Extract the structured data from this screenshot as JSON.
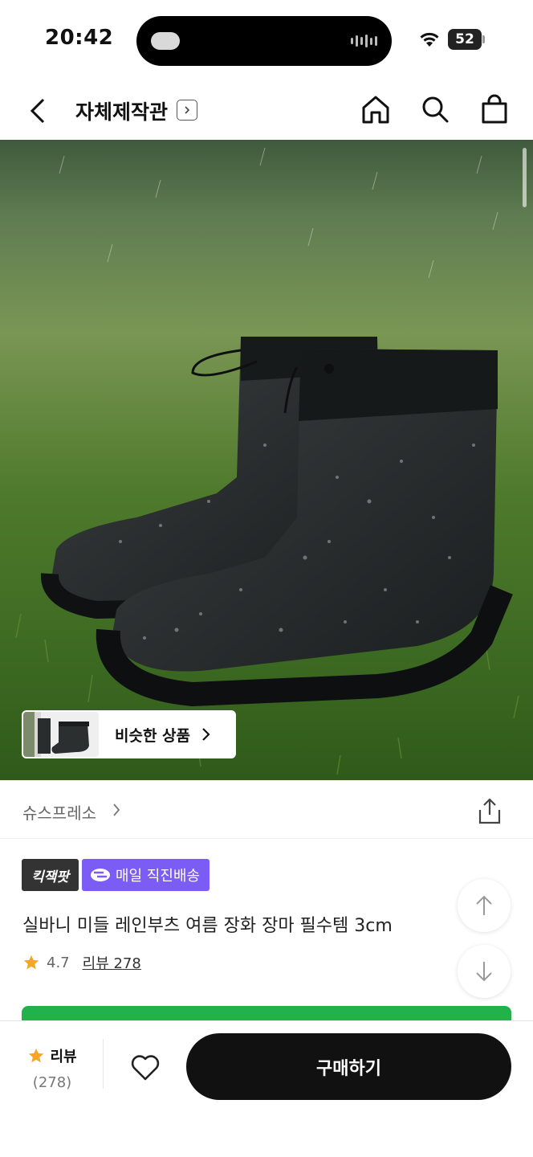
{
  "status_bar": {
    "time": "20:42",
    "battery": "52"
  },
  "nav": {
    "title": "자체제작관"
  },
  "similar": {
    "label": "비슷한 상품"
  },
  "brand": {
    "name": "슈스프레소"
  },
  "badges": {
    "quick": "킥잭팟",
    "delivery": "매일 직진배송"
  },
  "product": {
    "title": "실바니 미들 레인부츠 여름 장화 장마 필수템 3cm",
    "rating": "4.7",
    "review_text": "리뷰 278"
  },
  "bottom_bar": {
    "review_label": "리뷰",
    "review_count": "(278)",
    "buy_label": "구매하기"
  },
  "colors": {
    "accent_purple": "#7b5cf5",
    "star": "#f5a623",
    "green": "#22b24c",
    "dark": "#111111"
  },
  "icons": [
    "back-icon",
    "chevron-right-icon",
    "home-icon",
    "search-icon",
    "shopping-bag-icon",
    "share-icon",
    "arrow-up-icon",
    "arrow-down-icon",
    "star-icon",
    "heart-icon",
    "wifi-icon"
  ]
}
